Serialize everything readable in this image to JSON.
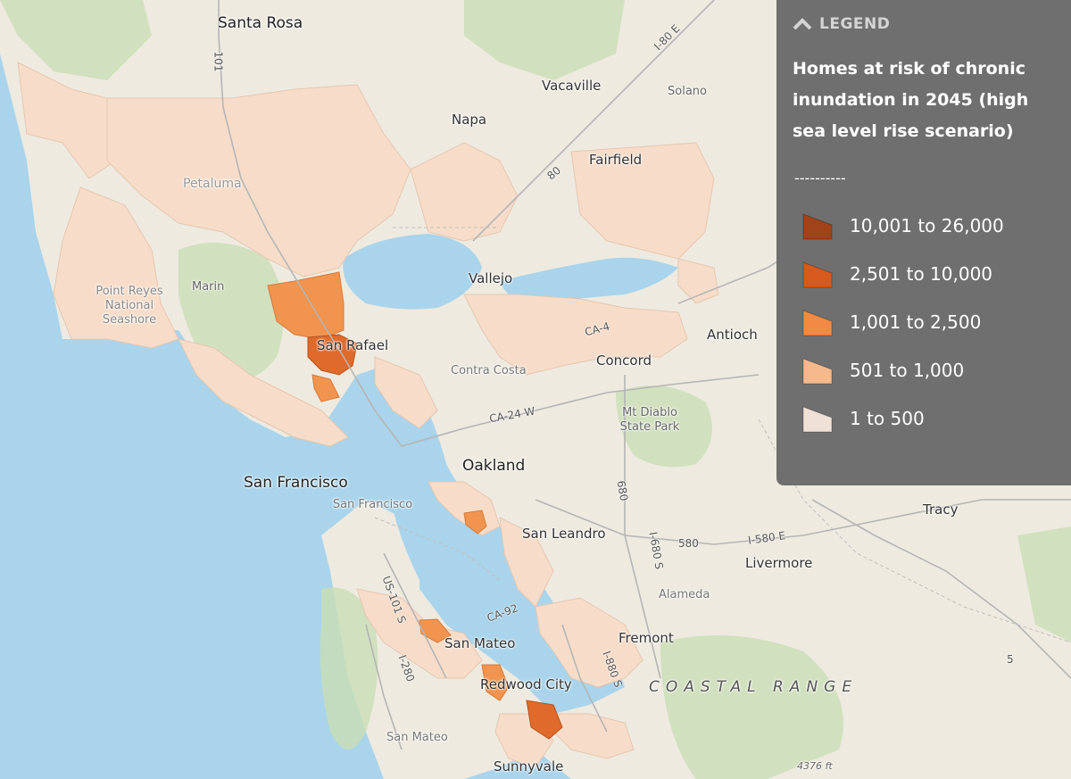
{
  "legend": {
    "header": "LEGEND",
    "title": "Homes at risk of chronic inundation in 2045 (high sea level rise scenario)",
    "separator": "----------",
    "items": [
      {
        "label": "10,001 to 26,000",
        "color": "#a0421a"
      },
      {
        "label": "2,501 to 10,000",
        "color": "#d65a1d"
      },
      {
        "label": "1,001 to 2,500",
        "color": "#f08a44"
      },
      {
        "label": "501 to 1,000",
        "color": "#f6b98c"
      },
      {
        "label": "1 to 500",
        "color": "#efe1d6"
      }
    ]
  },
  "places": {
    "santa_rosa": "Santa Rosa",
    "vacaville": "Vacaville",
    "solano": "Solano",
    "napa": "Napa",
    "fairfield": "Fairfield",
    "petaluma": "Petaluma",
    "marin": "Marin",
    "point_reyes": "Point Reyes National Seashore",
    "vallejo": "Vallejo",
    "san_rafael": "San Rafael",
    "antioch": "Antioch",
    "concord": "Concord",
    "contra_costa": "Contra Costa",
    "mt_diablo": "Mt Diablo State Park",
    "oakland": "Oakland",
    "san_francisco": "San Francisco",
    "san_francisco_county": "San Francisco",
    "tracy": "Tracy",
    "san_leandro": "San Leandro",
    "livermore": "Livermore",
    "alameda": "Alameda",
    "fremont": "Fremont",
    "san_mateo": "San Mateo",
    "redwood_city": "Redwood City",
    "coastal_range": "COASTAL RANGE",
    "san_mateo_county": "San Mateo",
    "sunnyvale": "Sunnyvale",
    "elevation": "4376 ft"
  },
  "roads": {
    "us101": "101",
    "i80e": "I-80 E",
    "i80": "80",
    "i680": "680",
    "ca24w": "CA-24 W",
    "i580": "580",
    "i580e": "I-580 E",
    "i680s": "I-680 S",
    "ca92": "CA-92",
    "us101s": "US-101 S",
    "i880s": "I-880 S",
    "i280": "I-280",
    "i5": "5",
    "ca4": "CA-4"
  }
}
